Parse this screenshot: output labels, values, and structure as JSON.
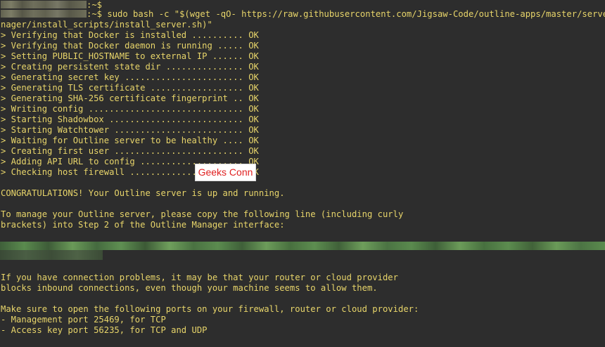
{
  "terminal": {
    "prompt_lines": [
      {
        "suffix": ":~$",
        "command": ""
      },
      {
        "suffix": ":~$ ",
        "command": "sudo bash -c \"$(wget -qO- https://raw.githubusercontent.com/Jigsaw-Code/outline-apps/master/server_ma"
      }
    ],
    "command_continuation": "nager/install_scripts/install_server.sh)\"",
    "steps": [
      "> Verifying that Docker is installed .......... OK",
      "> Verifying that Docker daemon is running ..... OK",
      "> Setting PUBLIC_HOSTNAME to external IP ...... OK",
      "> Creating persistent state dir ............... OK",
      "> Generating secret key ....................... OK",
      "> Generating TLS certificate .................. OK",
      "> Generating SHA-256 certificate fingerprint .. OK",
      "> Writing config .............................. OK",
      "> Starting Shadowbox .......................... OK",
      "> Starting Watchtower ......................... OK",
      "> Waiting for Outline server to be healthy .... OK",
      "> Creating first user ......................... OK",
      "> Adding API URL to config .................... OK",
      "> Checking host firewall ...................... OK"
    ],
    "congrats": "CONGRATULATIONS! Your Outline server is up and running.",
    "manage_line_1": "To manage your Outline server, please copy the following line (including curly",
    "manage_line_2": "brackets) into Step 2 of the Outline Manager interface:",
    "connection_line_1": "If you have connection problems, it may be that your router or cloud provider",
    "connection_line_2": "blocks inbound connections, even though your machine seems to allow them.",
    "ports_intro": "Make sure to open the following ports on your firewall, router or cloud provider:",
    "ports": [
      "- Management port 25469, for TCP",
      "- Access key port 56235, for TCP and UDP"
    ]
  },
  "watermark": {
    "text": "Geeks Conn"
  },
  "colors": {
    "background": "#2d2d2d",
    "text": "#e8d56a",
    "watermark_text": "#e02020"
  }
}
